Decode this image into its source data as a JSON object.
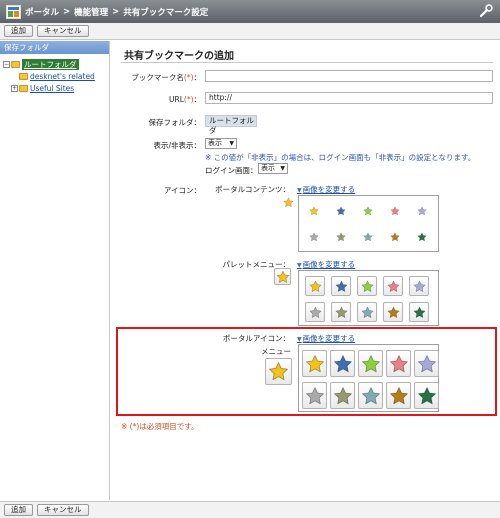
{
  "title": {
    "crumb1": "ポータル",
    "crumb2": "機能管理",
    "crumb3": "共有ブックマーク設定",
    "sep": ">"
  },
  "toolbar": {
    "add": "追加",
    "cancel": "キャンセル"
  },
  "sidebar": {
    "header": "保存フォルダ",
    "tree": [
      {
        "label": "ルートフォルダ",
        "expand": "−",
        "selected": true
      },
      {
        "label": "desknet's related",
        "expand": ""
      },
      {
        "label": "Useful Sites",
        "expand": "+"
      }
    ]
  },
  "form": {
    "page_title": "共有ブックマークの追加",
    "bookmark_name_label": "ブックマーク名",
    "url_label": "URL",
    "req_mark": "(*)",
    "colon": "：",
    "url_value": "http://",
    "folder_label": "保存フォルダ",
    "folder_value": "ルートフォルダ",
    "display_label": "表示/非表示",
    "display_value": "表示",
    "display_note": "※ この値が「非表示」の場合は、ログイン画面も「非表示」の設定となります。",
    "login_label": "ログイン画面：",
    "login_value": "表示",
    "icon_label": "アイコン",
    "portal_contents_label": "ポータルコンテンツ",
    "change_image": "画像を変更する",
    "palette_menu_label": "パレットメニュー",
    "portal_icon_label": "ポータルアイコン",
    "menu_label": "メニュー",
    "required_note": "※ (*)は必須項目です。"
  },
  "stars": {
    "colors": [
      "#f5c316",
      "#3d6fb0",
      "#8bd13a",
      "#ec7d85",
      "#a7a9da",
      "#a9aaaa",
      "#97996e",
      "#7fabb3",
      "#b57d14",
      "#257243"
    ],
    "selected_color": "#f5c316"
  }
}
